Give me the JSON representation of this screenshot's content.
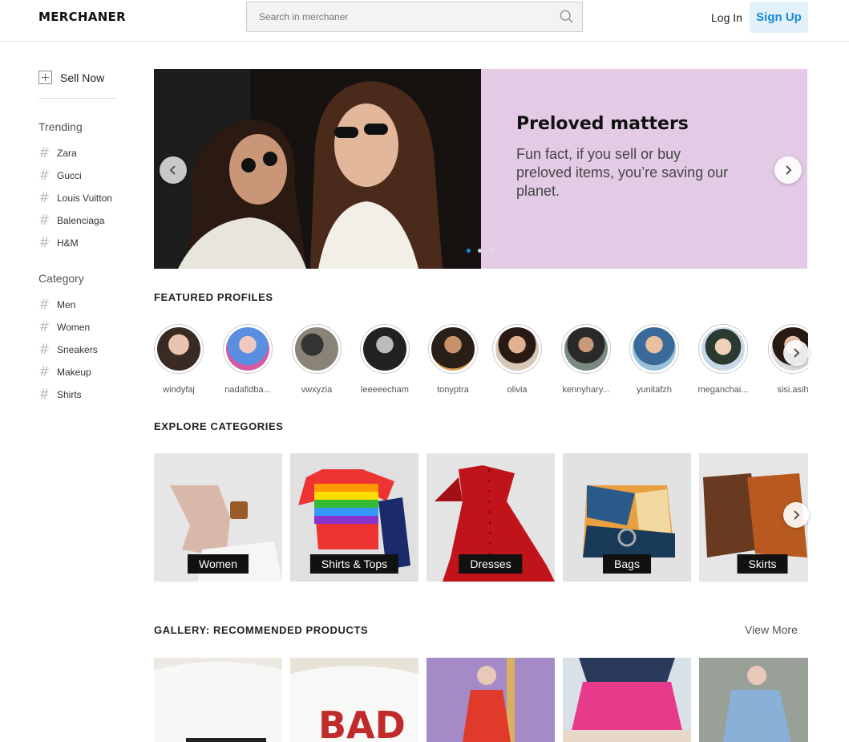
{
  "header": {
    "logo": "MERCHANER",
    "search_placeholder": "Search in merchaner",
    "login": "Log In",
    "signup": "Sign Up"
  },
  "sidebar": {
    "sell_now": "Sell Now",
    "trending_title": "Trending",
    "trending": [
      "Zara",
      "Gucci",
      "Louis Vuitton",
      "Balenciaga",
      "H&M"
    ],
    "category_title": "Category",
    "categories": [
      "Men",
      "Women",
      "Sneakers",
      "Makeup",
      "Shirts"
    ]
  },
  "banner": {
    "title": "Preloved matters",
    "subtitle": "Fun fact, if you sell or buy preloved items, you’re saving our planet.",
    "slides": 3,
    "active_slide": 1
  },
  "featured": {
    "title": "FEATURED PROFILES",
    "profiles": [
      "windyfaj",
      "nadafidba...",
      "vwxyzia",
      "leeeeecham",
      "tonyptra",
      "olivia",
      "kennyhary...",
      "yunitafzh",
      "meganchai...",
      "sisi.asih"
    ]
  },
  "explore": {
    "title": "EXPLORE CATEGORIES",
    "categories": [
      "Women",
      "Shirts & Tops",
      "Dresses",
      "Bags",
      "Skirts"
    ]
  },
  "gallery": {
    "title": "GALLERY: RECOMMENDED PRODUCTS",
    "view_more": "View More"
  },
  "colors": {
    "accent": "#1a8ad6",
    "banner_bg": "#e3cbe6"
  },
  "icons": [
    "search-icon",
    "plus-icon",
    "hash-icon",
    "chevron-left-icon",
    "chevron-right-icon"
  ]
}
